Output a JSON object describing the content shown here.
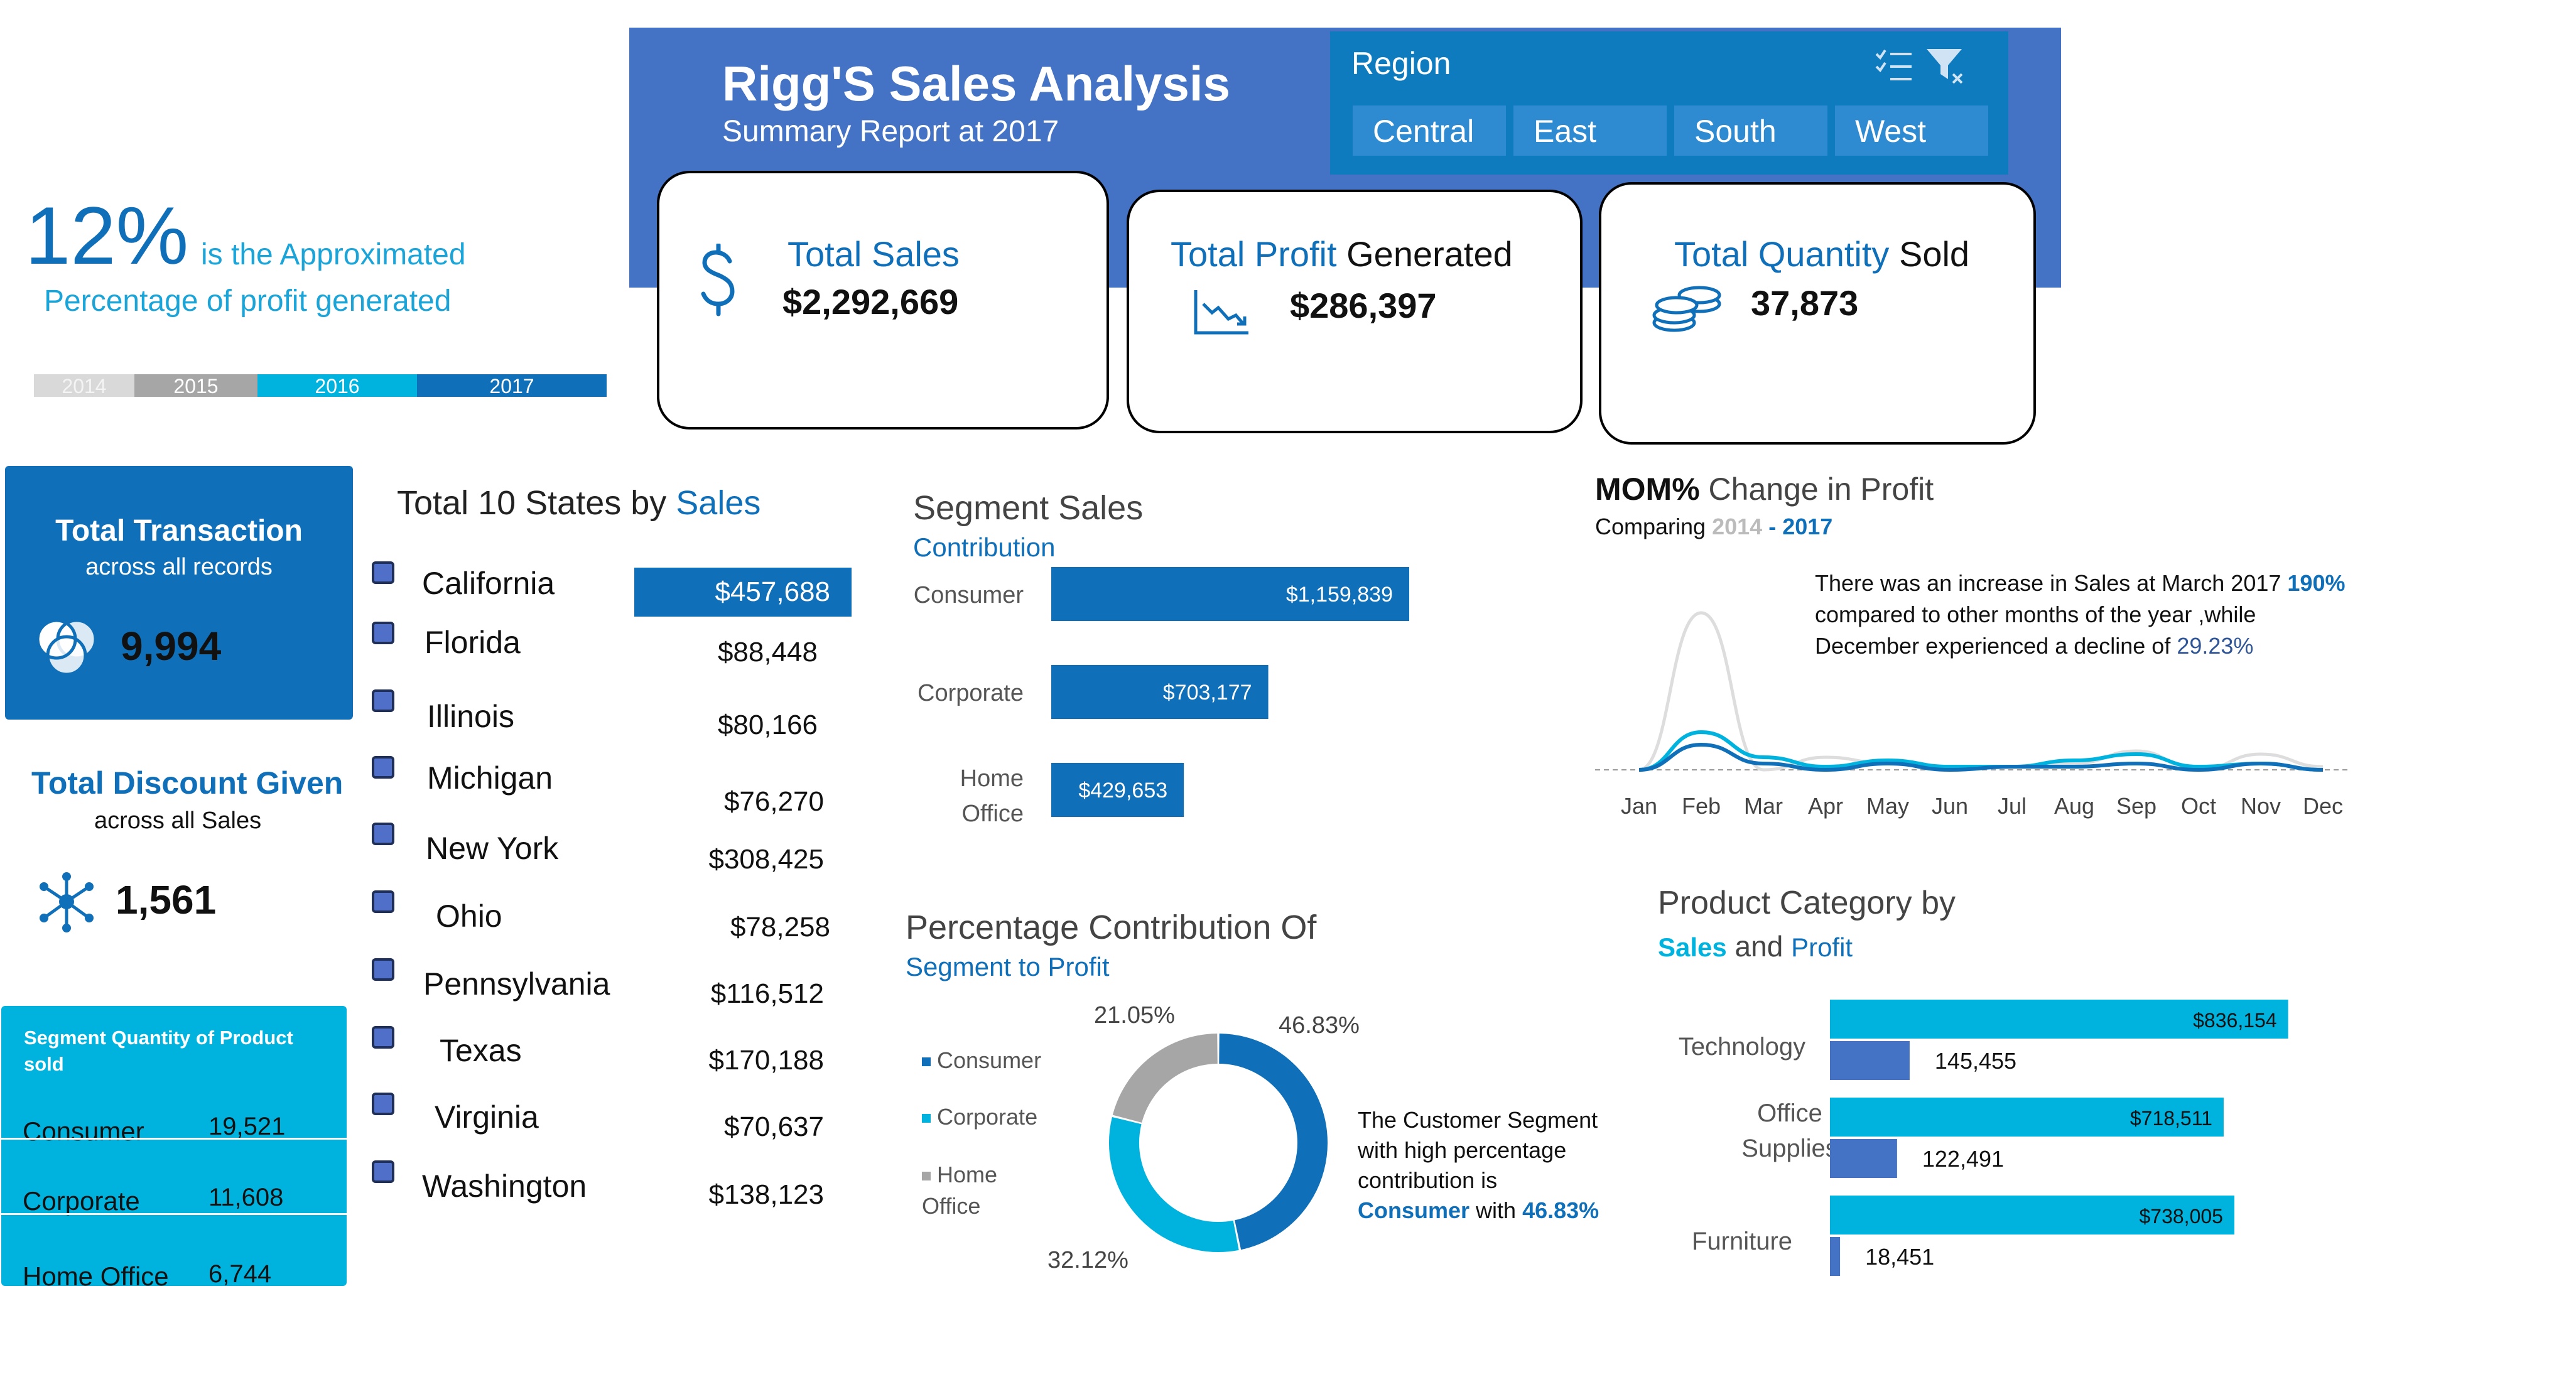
{
  "header": {
    "title": "Rigg'S Sales Analysis",
    "subtitle": "Summary Report at 2017",
    "region": {
      "label": "Region",
      "options": [
        "Central",
        "East",
        "South",
        "West"
      ]
    }
  },
  "kpis": {
    "total_sales": {
      "title": "Total Sales",
      "value": "$2,292,669"
    },
    "total_profit": {
      "title_accent": "Total Profit",
      "title_rest": " Generated",
      "value": "$286,397"
    },
    "total_quantity": {
      "title_accent": "Total Quantity",
      "title_rest": " Sold",
      "value": "37,873"
    }
  },
  "profit_pct": {
    "value": "12%",
    "text1": "is the Approximated",
    "text2": "Percentage of profit generated",
    "years": [
      "2014",
      "2015",
      "2016",
      "2017"
    ]
  },
  "total_transaction": {
    "title": "Total Transaction",
    "subtitle": "across all records",
    "value": "9,994"
  },
  "total_discount": {
    "title": "Total Discount Given",
    "subtitle": "across all Sales",
    "value": "1,561"
  },
  "segment_quantity": {
    "title": "Segment Quantity of Product sold",
    "rows": [
      {
        "label": "Consumer",
        "value": "19,521"
      },
      {
        "label": "Corporate",
        "value": "11,608"
      },
      {
        "label": "Home Office",
        "value": "6,744"
      }
    ]
  },
  "top_states": {
    "title_main": "Total 10 States by ",
    "title_accent": "Sales",
    "states": [
      {
        "name": "California",
        "value": "$457,688"
      },
      {
        "name": "Florida",
        "value": "$88,448"
      },
      {
        "name": "Illinois",
        "value": "$80,166"
      },
      {
        "name": "Michigan",
        "value": "$76,270"
      },
      {
        "name": "New York",
        "value": "$308,425"
      },
      {
        "name": "Ohio",
        "value": "$78,258"
      },
      {
        "name": "Pennsylvania",
        "value": "$116,512"
      },
      {
        "name": "Texas",
        "value": "$170,188"
      },
      {
        "name": "Virginia",
        "value": "$70,637"
      },
      {
        "name": "Washington",
        "value": "$138,123"
      }
    ]
  },
  "segment_sales": {
    "title": "Segment Sales",
    "subtitle": "Contribution"
  },
  "profit_contribution": {
    "title": "Percentage Contribution Of",
    "subtitle": "Segment to Profit",
    "note_line1": "The Customer Segment",
    "note_line2": "with high percentage",
    "note_line3": "contribution is",
    "note_seg": "Consumer",
    "note_with": " with ",
    "note_pct": "46.83%"
  },
  "mom": {
    "title_bold": "MOM%",
    "title_rest": " Change in Profit",
    "sub_prefix": "Comparing ",
    "sub_y1": "2014",
    "sub_dash": " - ",
    "sub_y2": "2017",
    "note_part1": "There was an increase in Sales at March 2017 ",
    "note_pct1": "190%",
    "note_part2": "compared to other months of the year  ,while",
    "note_part3": "December experienced a decline of ",
    "note_pct2": "29.23%"
  },
  "product_category": {
    "title": "Product Category by",
    "sub_sales": "Sales",
    "sub_and": " and ",
    "sub_profit": "Profit"
  },
  "colors": {
    "dark_blue": "#0F6FB8",
    "cyan": "#00B3DF",
    "header_blue": "#4472C4",
    "grey": "#A6A6A6"
  },
  "chart_data": [
    {
      "id": "segment-sales",
      "type": "bar",
      "orientation": "horizontal",
      "categories": [
        "Consumer",
        "Corporate",
        "Home Office"
      ],
      "values": [
        1159839,
        703177,
        429653
      ],
      "labels": [
        "$1,159,839",
        "$703,177",
        "$429,653"
      ],
      "color": "#0F6FB8"
    },
    {
      "id": "segment-profit",
      "type": "pie",
      "donut": true,
      "categories": [
        "Consumer",
        "Corporate",
        "Home Office"
      ],
      "values": [
        46.83,
        32.12,
        21.05
      ],
      "labels": [
        "46.83%",
        "32.12%",
        "21.05%"
      ],
      "colors": [
        "#0F6FB8",
        "#00B3DF",
        "#A6A6A6"
      ]
    },
    {
      "id": "mom-profit",
      "type": "line",
      "x": [
        "Jan",
        "Feb",
        "Mar",
        "Apr",
        "May",
        "Jun",
        "Jul",
        "Aug",
        "Sep",
        "Oct",
        "Nov",
        "Dec"
      ],
      "series": [
        {
          "values": [
            0,
            2.5,
            0,
            0.2,
            0.1,
            0,
            0.05,
            0.1,
            0.3,
            0,
            0.25,
            0.05
          ],
          "color": "#DDDDDD"
        },
        {
          "values": [
            0,
            0.6,
            0.2,
            0.05,
            0.15,
            0.05,
            0.05,
            0.15,
            0.25,
            0.05,
            0.1,
            0
          ],
          "color": "#00B3DF"
        },
        {
          "values": [
            0,
            0.4,
            0.1,
            0,
            0.1,
            0,
            0.05,
            0.05,
            0.1,
            0,
            0.1,
            0
          ],
          "color": "#0F6FB8"
        }
      ],
      "baseline": 0
    },
    {
      "id": "product-category",
      "type": "bar",
      "orientation": "horizontal",
      "categories": [
        "Technology",
        "Office Supplies",
        "Furniture"
      ],
      "series": [
        {
          "name": "Sales",
          "values": [
            836154,
            718511,
            738005
          ],
          "labels": [
            "$836,154",
            "$718,511",
            "$738,005"
          ],
          "color": "#00B3DF"
        },
        {
          "name": "Profit",
          "values": [
            145455,
            122491,
            18451
          ],
          "labels": [
            "145,455",
            "122,491",
            "18,451"
          ],
          "color": "#4472C4"
        }
      ]
    }
  ]
}
